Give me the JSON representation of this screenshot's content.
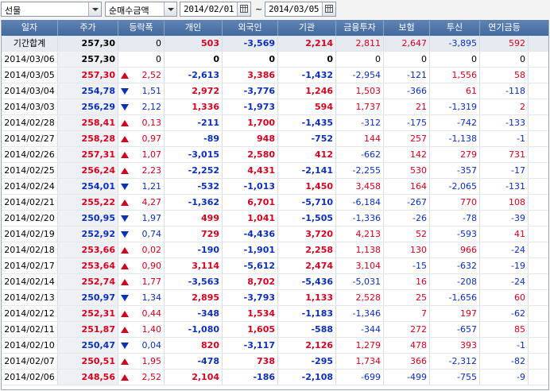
{
  "toolbar": {
    "market_select": "선물",
    "metric_select": "순매수금액",
    "date_from": "2014/02/01",
    "date_to": "2014/03/05",
    "tilde": "~"
  },
  "columns": [
    "일자",
    "주가",
    "등락폭",
    "개인",
    "외국인",
    "기관",
    "금융투자",
    "보험",
    "투신",
    "연기금등"
  ],
  "summary": {
    "label": "기간합계",
    "price": "257,30",
    "chg": "0",
    "vals": [
      "503",
      "-3,569",
      "2,214",
      "2,811",
      "2,647",
      "-3,895",
      "592"
    ]
  },
  "rows": [
    {
      "date": "2014/03/06",
      "price": "257,30",
      "dir": "none",
      "chg": "0",
      "vals": [
        "0",
        "0",
        "0",
        "0",
        "0",
        "0",
        "0"
      ]
    },
    {
      "date": "2014/03/05",
      "price": "257,30",
      "dir": "up",
      "chg": "2,52",
      "vals": [
        "-2,613",
        "3,386",
        "-1,432",
        "-2,954",
        "-121",
        "1,556",
        "58"
      ]
    },
    {
      "date": "2014/03/04",
      "price": "254,78",
      "dir": "down",
      "chg": "1,51",
      "vals": [
        "2,972",
        "-3,776",
        "1,246",
        "1,503",
        "-366",
        "61",
        "-118"
      ]
    },
    {
      "date": "2014/03/03",
      "price": "256,29",
      "dir": "down",
      "chg": "2,12",
      "vals": [
        "1,336",
        "-1,973",
        "594",
        "1,737",
        "21",
        "-1,319",
        "2"
      ]
    },
    {
      "date": "2014/02/28",
      "price": "258,41",
      "dir": "up",
      "chg": "0,13",
      "vals": [
        "-211",
        "1,700",
        "-1,435",
        "-312",
        "-175",
        "-742",
        "-133"
      ]
    },
    {
      "date": "2014/02/27",
      "price": "258,28",
      "dir": "up",
      "chg": "0,97",
      "vals": [
        "-89",
        "948",
        "-752",
        "144",
        "257",
        "-1,138",
        "-1"
      ]
    },
    {
      "date": "2014/02/26",
      "price": "257,31",
      "dir": "up",
      "chg": "1,07",
      "vals": [
        "-3,015",
        "2,580",
        "412",
        "-662",
        "142",
        "279",
        "731"
      ]
    },
    {
      "date": "2014/02/25",
      "price": "256,24",
      "dir": "up",
      "chg": "2,23",
      "vals": [
        "-2,252",
        "4,431",
        "-2,141",
        "-2,255",
        "530",
        "-357",
        "-17"
      ]
    },
    {
      "date": "2014/02/24",
      "price": "254,01",
      "dir": "down",
      "chg": "1,21",
      "vals": [
        "-532",
        "-1,013",
        "1,450",
        "3,458",
        "164",
        "-2,065",
        "-131"
      ]
    },
    {
      "date": "2014/02/21",
      "price": "255,22",
      "dir": "up",
      "chg": "4,27",
      "vals": [
        "-1,362",
        "6,701",
        "-5,710",
        "-6,184",
        "-267",
        "770",
        "108"
      ]
    },
    {
      "date": "2014/02/20",
      "price": "250,95",
      "dir": "down",
      "chg": "1,97",
      "vals": [
        "499",
        "1,041",
        "-1,505",
        "-1,336",
        "-26",
        "-78",
        "-39"
      ]
    },
    {
      "date": "2014/02/19",
      "price": "252,92",
      "dir": "down",
      "chg": "0,74",
      "vals": [
        "729",
        "-4,436",
        "3,720",
        "4,213",
        "52",
        "-593",
        "41"
      ]
    },
    {
      "date": "2014/02/18",
      "price": "253,66",
      "dir": "up",
      "chg": "0,02",
      "vals": [
        "-190",
        "-1,901",
        "2,258",
        "1,138",
        "130",
        "966",
        "-24"
      ]
    },
    {
      "date": "2014/02/17",
      "price": "253,64",
      "dir": "up",
      "chg": "0,90",
      "vals": [
        "3,114",
        "-5,612",
        "2,474",
        "3,104",
        "-15",
        "-632",
        "-19"
      ]
    },
    {
      "date": "2014/02/14",
      "price": "252,74",
      "dir": "up",
      "chg": "1,77",
      "vals": [
        "-3,563",
        "8,702",
        "-5,436",
        "-5,031",
        "16",
        "-208",
        "-24"
      ]
    },
    {
      "date": "2014/02/13",
      "price": "250,97",
      "dir": "down",
      "chg": "1,34",
      "vals": [
        "2,895",
        "-3,793",
        "1,133",
        "2,528",
        "25",
        "-1,656",
        "60"
      ]
    },
    {
      "date": "2014/02/12",
      "price": "252,31",
      "dir": "up",
      "chg": "0,44",
      "vals": [
        "-348",
        "1,534",
        "-1,183",
        "-1,346",
        "7",
        "197",
        "-62"
      ]
    },
    {
      "date": "2014/02/11",
      "price": "251,87",
      "dir": "up",
      "chg": "1,40",
      "vals": [
        "-1,080",
        "1,605",
        "-588",
        "-344",
        "272",
        "-657",
        "85"
      ]
    },
    {
      "date": "2014/02/10",
      "price": "250,47",
      "dir": "down",
      "chg": "0,04",
      "vals": [
        "820",
        "-3,117",
        "2,126",
        "1,279",
        "478",
        "393",
        "-1"
      ]
    },
    {
      "date": "2014/02/07",
      "price": "250,51",
      "dir": "up",
      "chg": "1,95",
      "vals": [
        "-478",
        "738",
        "-295",
        "1,734",
        "366",
        "-2,312",
        "-82"
      ]
    },
    {
      "date": "2014/02/06",
      "price": "248,56",
      "dir": "up",
      "chg": "2,52",
      "vals": [
        "2,104",
        "-186",
        "-2,108",
        "-699",
        "-499",
        "-755",
        "-9"
      ]
    }
  ],
  "colors": {
    "up": "#d4001c",
    "down": "#0a2fb8",
    "header": "#4d72a6"
  }
}
